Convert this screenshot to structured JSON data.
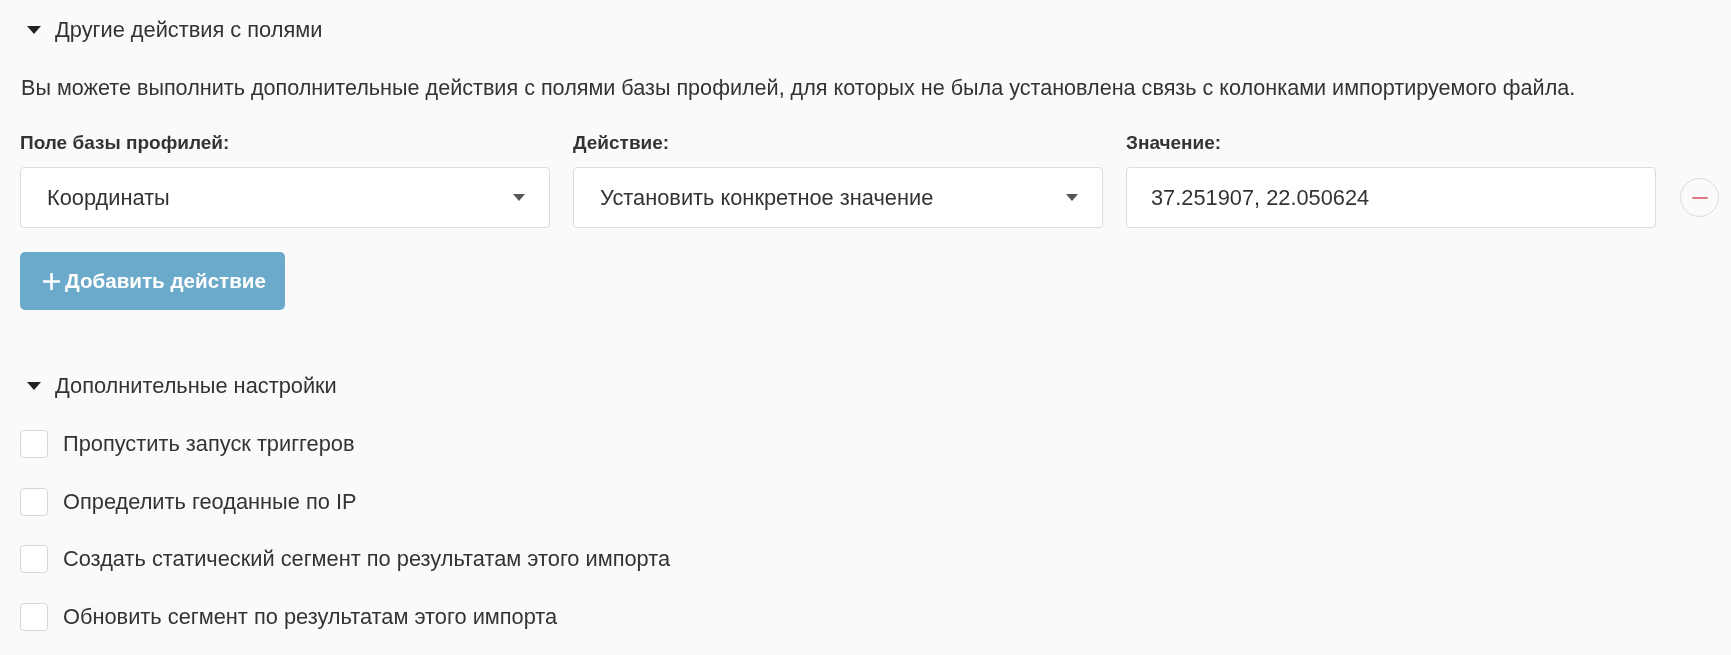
{
  "field_actions": {
    "title": "Другие действия с полями",
    "expanded": true,
    "description": "Вы можете выполнить дополнительные действия с полями базы профилей, для которых не была установлена связь с колонками импортируемого файла.",
    "columns": [
      "Поле базы профилей:",
      "Действие:",
      "Значение:"
    ],
    "actions": [
      {
        "field": "Координаты",
        "action": "Установить конкретное значение",
        "value": "37.251907, 22.050624"
      }
    ],
    "add_button": "Добавить действие"
  },
  "additional_settings": {
    "title": "Дополнительные настройки",
    "expanded": true,
    "options": [
      {
        "label": "Пропустить запуск триггеров",
        "checked": false
      },
      {
        "label": "Определить геоданные по IP",
        "checked": false
      },
      {
        "label": "Создать статический сегмент по результатам этого импорта",
        "checked": false
      },
      {
        "label": "Обновить сегмент по результатам этого импорта",
        "checked": false
      }
    ]
  }
}
